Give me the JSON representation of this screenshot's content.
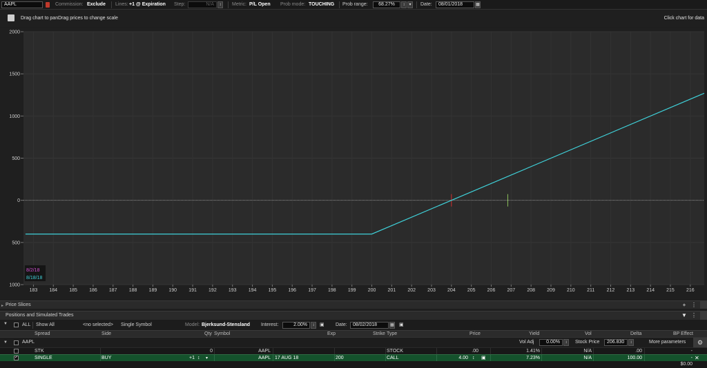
{
  "toolbar": {
    "symbol": "AAPL",
    "commission_label": "Commission:",
    "commission_value": "Exclude",
    "lines_label": "Lines:",
    "lines_value": "+1 @ Expiration",
    "step_label": "Step:",
    "step_value": "N/A",
    "metric_label": "Metric:",
    "metric_value": "P/L Open",
    "prob_mode_label": "Prob mode:",
    "prob_mode_value": "TOUCHING",
    "prob_range_label": "Prob range:",
    "prob_range_value": "68.27%",
    "date_label": "Date:",
    "date_value": "08/01/2018"
  },
  "hint": {
    "left": "Drag chart to panDrag prices to change scale",
    "right": "Click chart for data"
  },
  "chart_data": {
    "type": "line",
    "x_ticks": [
      183,
      184,
      185,
      186,
      187,
      188,
      189,
      190,
      191,
      192,
      193,
      194,
      195,
      196,
      197,
      198,
      199,
      200,
      201,
      202,
      203,
      204,
      205,
      206,
      207,
      208,
      209,
      210,
      211,
      212,
      213,
      214,
      215,
      216
    ],
    "y_ticks": [
      {
        "value": 2000,
        "label": "2000"
      },
      {
        "value": 1500,
        "label": "1500"
      },
      {
        "value": 1000,
        "label": "1000"
      },
      {
        "value": 500,
        "label": "500"
      },
      {
        "value": 0,
        "label": "0"
      },
      {
        "value": -500,
        "label": "500"
      },
      {
        "value": -1000,
        "label": "1000"
      }
    ],
    "xlim": [
      182.5,
      216.7
    ],
    "ylim": [
      -1000,
      2000
    ],
    "series": [
      {
        "name": "8/18/18",
        "color": "#3fd0d8",
        "x": [
          182.6,
          200,
          216.7
        ],
        "y": [
          -400,
          -400,
          1270
        ]
      }
    ],
    "legend": [
      {
        "label": "8/2/18",
        "color": "#d14fd1"
      },
      {
        "label": "8/18/18",
        "color": "#3fd0d8"
      }
    ],
    "markers": [
      {
        "x": 204,
        "color": "#d03030"
      },
      {
        "x": 206.83,
        "color": "#8bbf5a"
      }
    ],
    "grid": true,
    "zero_line": true
  },
  "panels": {
    "price_slices": "Price Slices",
    "positions": "Positions and Simulated Trades"
  },
  "trade_toolbar": {
    "all_label": "ALL",
    "show_all": "Show All",
    "no_selected": "<no selected>",
    "single_symbol": "Single Symbol",
    "model_label": "Model:",
    "model_value": "Bjerksund-Stensland",
    "interest_label": "Interest:",
    "interest_value": "2.00%",
    "date_label": "Date:",
    "date_value": "08/02/2018"
  },
  "columns": {
    "spread": "Spread",
    "side": "Side",
    "qty": "Qty",
    "symbol": "Symbol",
    "exp": "Exp",
    "strike": "Strike",
    "type": "Type",
    "price": "Price",
    "yield": "Yield",
    "vol": "Vol",
    "delta": "Delta",
    "bp_effect": "BP Effect"
  },
  "group": {
    "symbol": "AAPL",
    "vol_adj_label": "Vol Adj",
    "vol_adj_value": "0.00%",
    "stock_price_label": "Stock Price",
    "stock_price_value": "206.830",
    "more_parameters": "More parameters"
  },
  "rows": [
    {
      "spread": "STK",
      "side": "",
      "qty": "0",
      "symbol": "AAPL",
      "exp": "",
      "strike": "",
      "type": "STOCK",
      "price": ".00",
      "yield": "1.41%",
      "vol": "N/A",
      "delta": ".00",
      "bp": "-"
    },
    {
      "spread": "SINGLE",
      "side": "BUY",
      "qty": "+1",
      "symbol": "AAPL",
      "exp": "17 AUG 18",
      "strike": "200",
      "type": "CALL",
      "price": "4.00",
      "yield": "7.23%",
      "vol": "N/A",
      "delta": "100.00",
      "bp": "-"
    }
  ],
  "total": {
    "bp": "$0.00"
  },
  "colors": {
    "accent": "#3fd0d8",
    "selected_row": "#14522c"
  }
}
